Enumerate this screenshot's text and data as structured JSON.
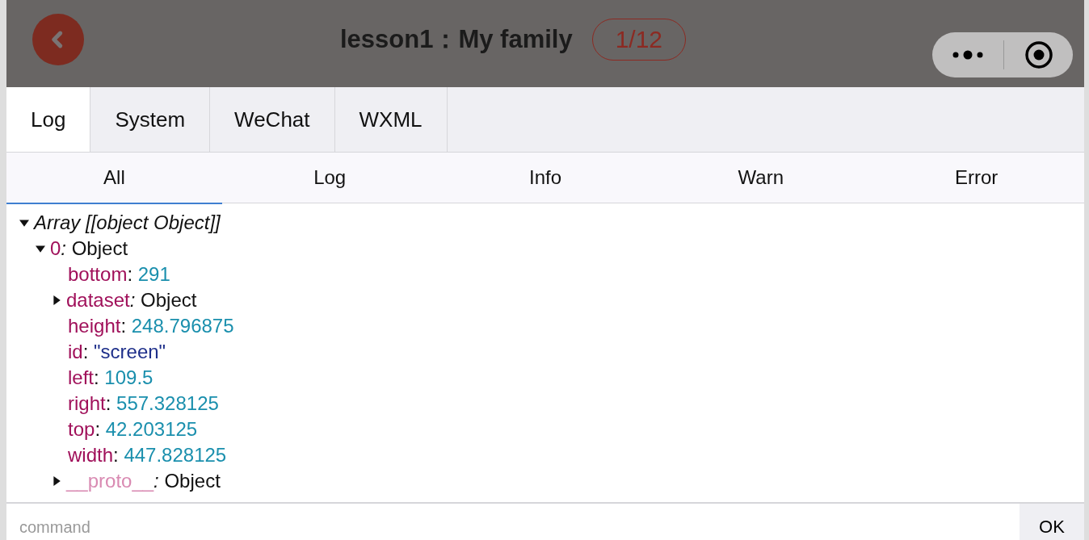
{
  "header": {
    "title": "lesson1：My family",
    "progress": "1/12"
  },
  "tabs": [
    {
      "label": "Log",
      "selected": true
    },
    {
      "label": "System",
      "selected": false
    },
    {
      "label": "WeChat",
      "selected": false
    },
    {
      "label": "WXML",
      "selected": false
    }
  ],
  "filters": [
    {
      "label": "All",
      "selected": true
    },
    {
      "label": "Log",
      "selected": false
    },
    {
      "label": "Info",
      "selected": false
    },
    {
      "label": "Warn",
      "selected": false
    },
    {
      "label": "Error",
      "selected": false
    }
  ],
  "log": [
    {
      "kind": "summary",
      "label": "Array [[object Object]]",
      "expanded": true,
      "children": [
        {
          "kind": "object",
          "key": "0",
          "separator": ": ",
          "value": "Object",
          "expanded": true,
          "children": [
            {
              "kind": "number",
              "key": "bottom",
              "separator": ": ",
              "value": "291"
            },
            {
              "kind": "object",
              "key": "dataset",
              "separator": ": ",
              "value": "Object",
              "expanded": false
            },
            {
              "kind": "number",
              "key": "height",
              "separator": ": ",
              "value": "248.796875"
            },
            {
              "kind": "string",
              "key": "id",
              "separator": ": ",
              "value": "\"screen\""
            },
            {
              "kind": "number",
              "key": "left",
              "separator": ": ",
              "value": "109.5"
            },
            {
              "kind": "number",
              "key": "right",
              "separator": ": ",
              "value": "557.328125"
            },
            {
              "kind": "number",
              "key": "top",
              "separator": ": ",
              "value": "42.203125"
            },
            {
              "kind": "number",
              "key": "width",
              "separator": ": ",
              "value": "447.828125"
            },
            {
              "kind": "proto",
              "key": "__proto__",
              "separator": ": ",
              "value": "Object",
              "expanded": false
            }
          ]
        }
      ]
    }
  ],
  "command": {
    "placeholder": "command",
    "button": "OK"
  }
}
